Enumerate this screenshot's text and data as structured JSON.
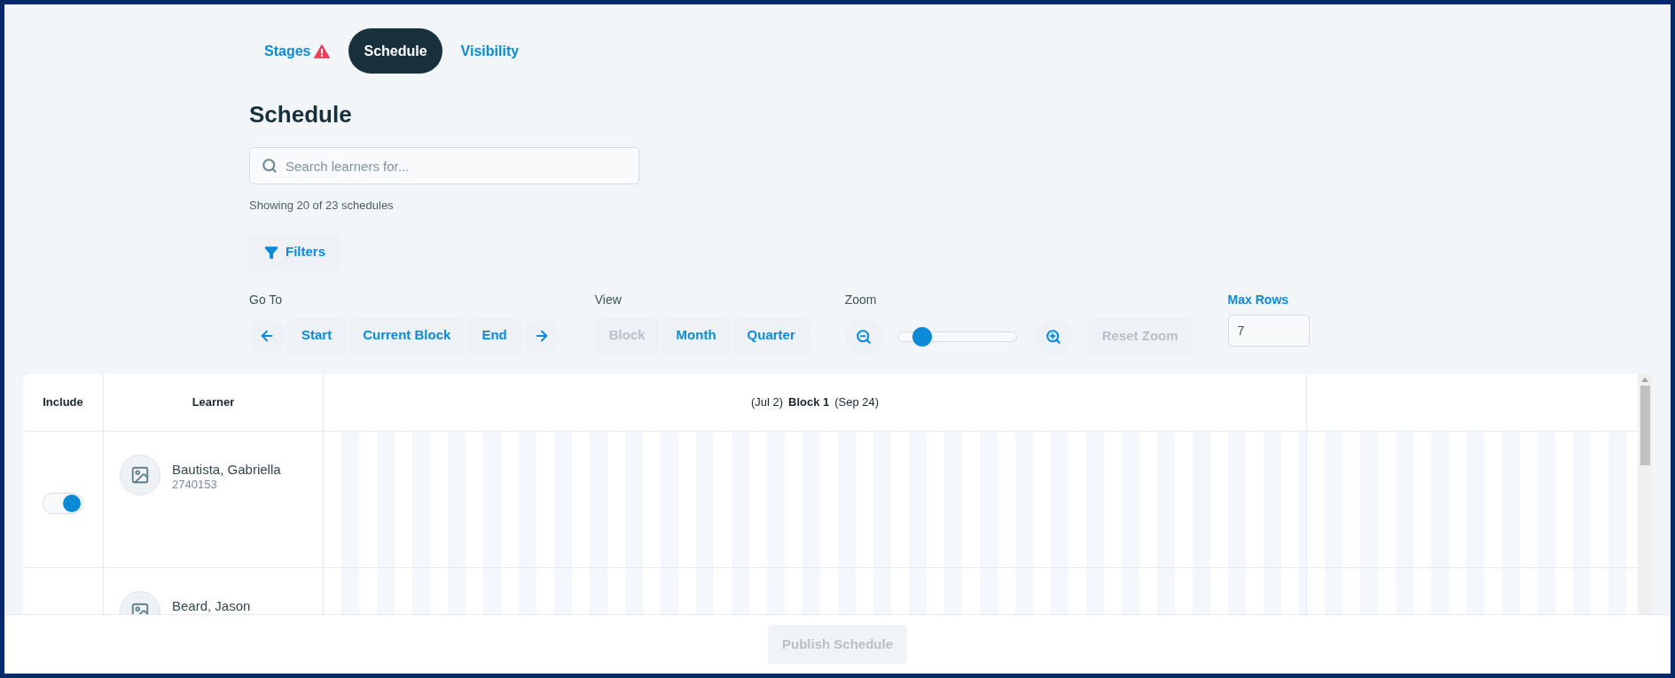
{
  "tabs": [
    {
      "label": "Stages",
      "selected": false,
      "warning": true
    },
    {
      "label": "Schedule",
      "selected": true,
      "warning": false
    },
    {
      "label": "Visibility",
      "selected": false,
      "warning": false
    }
  ],
  "heading": "Schedule",
  "search": {
    "placeholder": "Search learners for..."
  },
  "result_count": "Showing 20 of 23 schedules",
  "filters_button": "Filters",
  "go_to": {
    "label": "Go To",
    "buttons": [
      "Start",
      "Current Block",
      "End"
    ]
  },
  "view": {
    "label": "View",
    "options": [
      {
        "label": "Block",
        "disabled": true
      },
      {
        "label": "Month",
        "disabled": false
      },
      {
        "label": "Quarter",
        "disabled": false
      }
    ]
  },
  "zoom": {
    "label": "Zoom",
    "level": 0.15,
    "reset": {
      "label": "Reset Zoom",
      "disabled": true
    }
  },
  "max_rows": {
    "label": "Max Rows",
    "value": "7"
  },
  "table": {
    "columns": [
      "Include",
      "Learner"
    ],
    "block": {
      "start": "(Jul 2)",
      "name": "Block 1",
      "end": "(Sep 24)"
    },
    "rows": [
      {
        "name": "Bautista, Gabriella",
        "id": "2740153",
        "included": true
      },
      {
        "name": "Beard, Jason"
      }
    ]
  },
  "footer": {
    "publish": {
      "label": "Publish Schedule",
      "disabled": true
    }
  }
}
